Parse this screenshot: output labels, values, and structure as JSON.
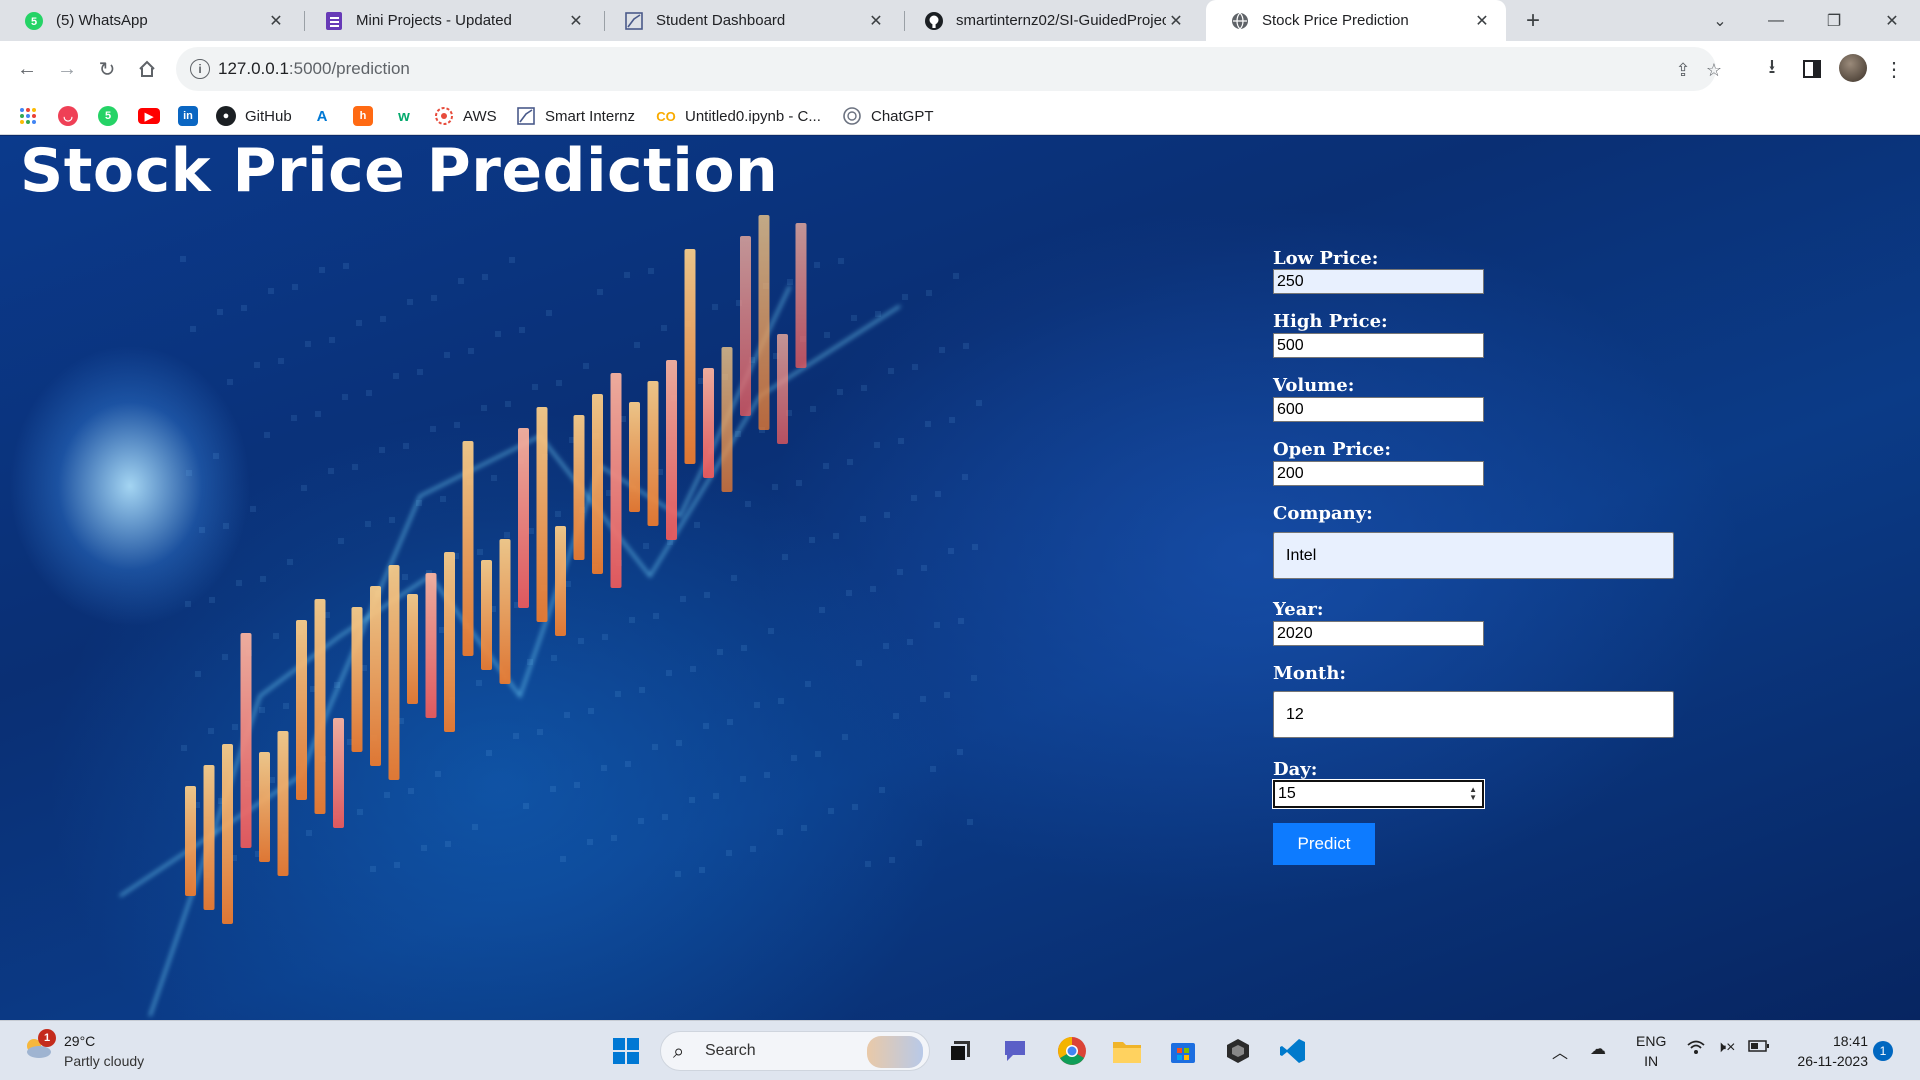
{
  "browser": {
    "tabs": [
      {
        "title": "(5) WhatsApp",
        "icon": "whatsapp-icon",
        "active": false
      },
      {
        "title": "Mini Projects - Updated",
        "icon": "forms-icon",
        "active": false
      },
      {
        "title": "Student Dashboard",
        "icon": "smartinternz-icon",
        "active": false
      },
      {
        "title": "smartinternz02/SI-GuidedProjec",
        "icon": "github-icon",
        "active": false
      },
      {
        "title": "Stock Price Prediction",
        "icon": "globe-icon",
        "active": true
      }
    ],
    "close_glyph": "✕",
    "url_host": "127.0.0.1",
    "url_path": ":5000/prediction",
    "bookmarks": [
      {
        "label": "",
        "icon": "apps-grid-icon"
      },
      {
        "label": "",
        "icon": "pocket-icon"
      },
      {
        "label": "",
        "icon": "whatsapp-icon"
      },
      {
        "label": "",
        "icon": "youtube-icon"
      },
      {
        "label": "",
        "icon": "linkedin-icon"
      },
      {
        "label": "GitHub",
        "icon": "github-icon"
      },
      {
        "label": "",
        "icon": "azure-icon"
      },
      {
        "label": "",
        "icon": "hashnode-icon"
      },
      {
        "label": "",
        "icon": "w3schools-icon"
      },
      {
        "label": "AWS",
        "icon": "aws-icon"
      },
      {
        "label": "Smart Internz",
        "icon": "smartinternz-icon"
      },
      {
        "label": "Untitled0.ipynb - C...",
        "icon": "colab-icon"
      },
      {
        "label": "ChatGPT",
        "icon": "chatgpt-icon"
      }
    ]
  },
  "page": {
    "title": "Stock Price Prediction",
    "form": {
      "fields": [
        {
          "label": "Low Price:",
          "value": "250"
        },
        {
          "label": "High Price:",
          "value": "500"
        },
        {
          "label": "Volume:",
          "value": "600"
        },
        {
          "label": "Open Price:",
          "value": "200"
        },
        {
          "label": "Company:",
          "value": "Intel"
        },
        {
          "label": "Year:",
          "value": "2020"
        },
        {
          "label": "Month:",
          "value": "12"
        },
        {
          "label": "Day:",
          "value": "15"
        }
      ],
      "submit_label": "Predict"
    }
  },
  "taskbar": {
    "weather_temp": "29°C",
    "weather_desc": "Partly cloudy",
    "weather_badge": "1",
    "search_label": "Search",
    "lang_1": "ENG",
    "lang_2": "IN",
    "time": "18:41",
    "date": "26-11-2023",
    "notification_count": "1",
    "apps": [
      "windows-start-icon",
      "task-view-icon",
      "teams-chat-icon",
      "chrome-icon",
      "file-explorer-icon",
      "microsoft-store-icon",
      "unity-icon",
      "vscode-icon"
    ]
  },
  "colors": {
    "accent_button": "#0d7bff",
    "page_background": "#0a2f74",
    "candle_orange": "#f7a24a"
  }
}
